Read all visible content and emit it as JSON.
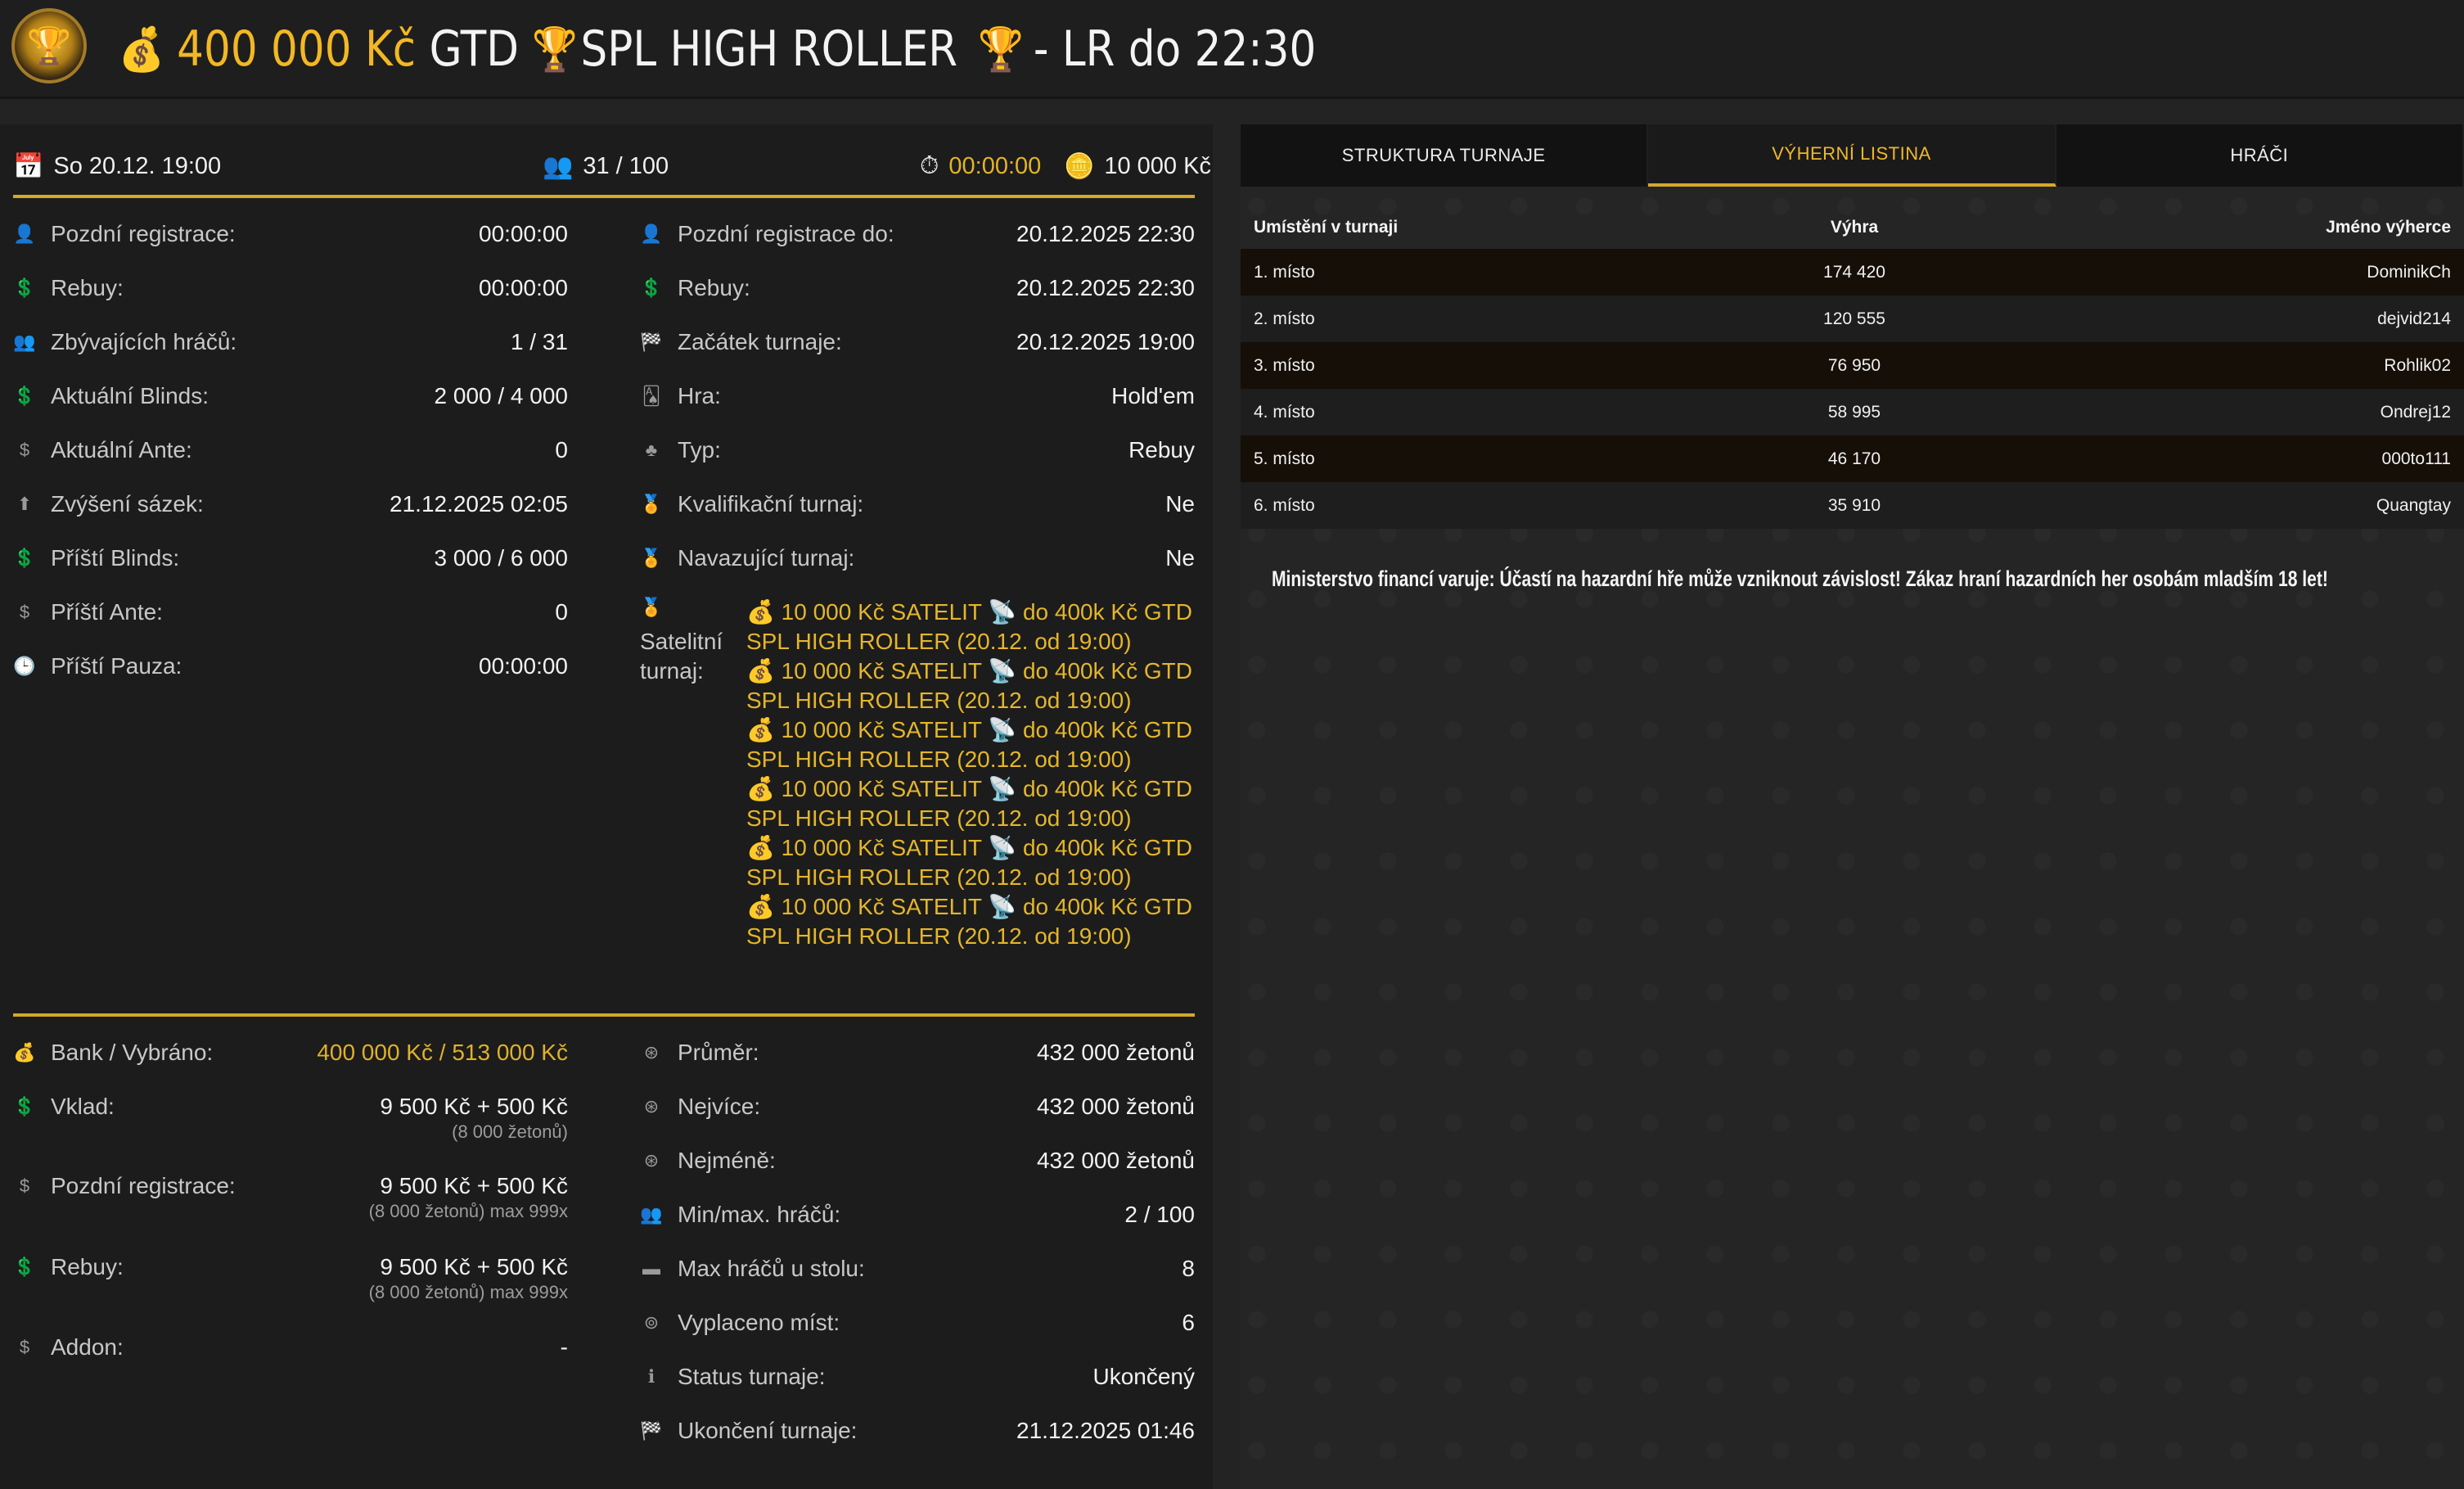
{
  "header": {
    "prize": "400 000 Kč",
    "gtd": "GTD",
    "name": "SPL HIGH ROLLER",
    "suffix": "- LR do 22:30",
    "money_icon": "💰",
    "trophy_icon": "🏆"
  },
  "topbar": {
    "date": "So 20.12. 19:00",
    "players": "31 / 100",
    "timer": "00:00:00",
    "buyin": "10 000 Kč"
  },
  "left_details": [
    {
      "icon": "user-clock-icon",
      "glyph": "👤",
      "label": "Pozdní registrace:",
      "value": "00:00:00"
    },
    {
      "icon": "rebuy-icon",
      "glyph": "💲",
      "label": "Rebuy:",
      "value": "00:00:00"
    },
    {
      "icon": "users-icon",
      "glyph": "👥",
      "label": "Zbývajících hráčů:",
      "value": "1 / 31"
    },
    {
      "icon": "blinds-icon",
      "glyph": "💲",
      "label": "Aktuální Blinds:",
      "value": "2 000 / 4 000"
    },
    {
      "icon": "ante-icon",
      "glyph": "$",
      "label": "Aktuální Ante:",
      "value": "0"
    },
    {
      "icon": "level-up-icon",
      "glyph": "⬆",
      "label": "Zvýšení sázek:",
      "value": "21.12.2025 02:05"
    },
    {
      "icon": "blinds-icon",
      "glyph": "💲",
      "label": "Příští Blinds:",
      "value": "3 000 / 6 000"
    },
    {
      "icon": "ante-icon",
      "glyph": "$",
      "label": "Příští Ante:",
      "value": "0"
    },
    {
      "icon": "clock-icon",
      "glyph": "🕒",
      "label": "Příští Pauza:",
      "value": "00:00:00"
    }
  ],
  "right_details": [
    {
      "icon": "user-clock-icon",
      "glyph": "👤",
      "label": "Pozdní registrace do:",
      "value": "20.12.2025 22:30"
    },
    {
      "icon": "rebuy-icon",
      "glyph": "💲",
      "label": "Rebuy:",
      "value": "20.12.2025 22:30"
    },
    {
      "icon": "flag-icon",
      "glyph": "🏁",
      "label": "Začátek turnaje:",
      "value": "20.12.2025 19:00"
    },
    {
      "icon": "game-icon",
      "glyph": "🂡",
      "label": "Hra:",
      "value": "Hold'em"
    },
    {
      "icon": "type-icon",
      "glyph": "♣",
      "label": "Typ:",
      "value": "Rebuy"
    },
    {
      "icon": "medal-icon",
      "glyph": "🏅",
      "label": "Kvalifikační turnaj:",
      "value": "Ne"
    },
    {
      "icon": "medal-icon",
      "glyph": "🏅",
      "label": "Navazující turnaj:",
      "value": "Ne"
    }
  ],
  "satellite": {
    "label_line1": "Satelitní",
    "label_line2": "turnaj:",
    "items": [
      {
        "a": "10 000 Kč SATELIT",
        "b": "do 400k Kč GTD",
        "c": "SPL HIGH ROLLER (20.12. od 19:00)"
      },
      {
        "a": "10 000 Kč SATELIT",
        "b": "do 400k Kč GTD",
        "c": "SPL HIGH ROLLER (20.12. od 19:00)"
      },
      {
        "a": "10 000 Kč SATELIT",
        "b": "do 400k Kč GTD",
        "c": "SPL HIGH ROLLER (20.12. od 19:00)"
      },
      {
        "a": "10 000 Kč SATELIT",
        "b": "do 400k Kč GTD",
        "c": "SPL HIGH ROLLER (20.12. od 19:00)"
      },
      {
        "a": "10 000 Kč SATELIT",
        "b": "do 400k Kč GTD",
        "c": "SPL HIGH ROLLER (20.12. od 19:00)"
      },
      {
        "a": "10 000 Kč SATELIT",
        "b": "do 400k Kč GTD",
        "c": "SPL HIGH ROLLER (20.12. od 19:00)"
      }
    ]
  },
  "bottom_left": [
    {
      "icon": "bank-icon",
      "glyph": "💰",
      "label": "Bank / Vybráno:",
      "value": "400 000 Kč / 513 000 Kč",
      "gold": true,
      "sub": ""
    },
    {
      "icon": "deposit-icon",
      "glyph": "💲",
      "label": "Vklad:",
      "value": "9 500 Kč + 500 Kč",
      "sub": "(8 000 žetonů)"
    },
    {
      "icon": "late-reg-icon",
      "glyph": "$",
      "label": "Pozdní registrace:",
      "value": "9 500 Kč + 500 Kč",
      "sub": "(8 000 žetonů) max 999x"
    },
    {
      "icon": "rebuy-icon",
      "glyph": "💲",
      "label": "Rebuy:",
      "value": "9 500 Kč + 500 Kč",
      "sub": "(8 000 žetonů) max 999x"
    },
    {
      "icon": "addon-icon",
      "glyph": "$",
      "label": "Addon:",
      "value": "-",
      "sub": ""
    }
  ],
  "bottom_right": [
    {
      "icon": "chip-icon",
      "glyph": "⊛",
      "label": "Průměr:",
      "value": "432 000 žetonů"
    },
    {
      "icon": "chip-icon",
      "glyph": "⊛",
      "label": "Nejvíce:",
      "value": "432 000 žetonů"
    },
    {
      "icon": "chip-icon",
      "glyph": "⊛",
      "label": "Nejméně:",
      "value": "432 000 žetonů"
    },
    {
      "icon": "users-icon",
      "glyph": "👥",
      "label": "Min/max. hráčů:",
      "value": "2 / 100"
    },
    {
      "icon": "table-icon",
      "glyph": "▬",
      "label": "Max hráčů u stolu:",
      "value": "8"
    },
    {
      "icon": "paid-icon",
      "glyph": "⊚",
      "label": "Vyplaceno míst:",
      "value": "6"
    },
    {
      "icon": "info-icon",
      "glyph": "ℹ",
      "label": "Status turnaje:",
      "value": "Ukončený"
    },
    {
      "icon": "flag-icon",
      "glyph": "🏁",
      "label": "Ukončení turnaje:",
      "value": "21.12.2025 01:46"
    }
  ],
  "tabs": [
    "STRUKTURA TURNAJE",
    "VÝHERNÍ LISTINA",
    "HRÁČI"
  ],
  "active_tab": 1,
  "payout_table": {
    "headers": [
      "Umístění v turnaji",
      "Výhra",
      "Jméno výherce"
    ],
    "rows": [
      [
        "1. místo",
        "174 420",
        "DominikCh"
      ],
      [
        "2. místo",
        "120 555",
        "dejvid214"
      ],
      [
        "3. místo",
        "76 950",
        "Rohlik02"
      ],
      [
        "4. místo",
        "58 995",
        "Ondrej12"
      ],
      [
        "5. místo",
        "46 170",
        "000to111"
      ],
      [
        "6. místo",
        "35 910",
        "Quangtay"
      ]
    ]
  },
  "warning": "Ministerstvo financí varuje: Účastí na hazardní hře může vzniknout závislost! Zákaz hraní hazardních her osobám mladším 18 let!",
  "colors": {
    "accent": "#d4a928",
    "gold_text": "#e0b12a",
    "background": "#232323",
    "panel": "#1c1c1c"
  }
}
